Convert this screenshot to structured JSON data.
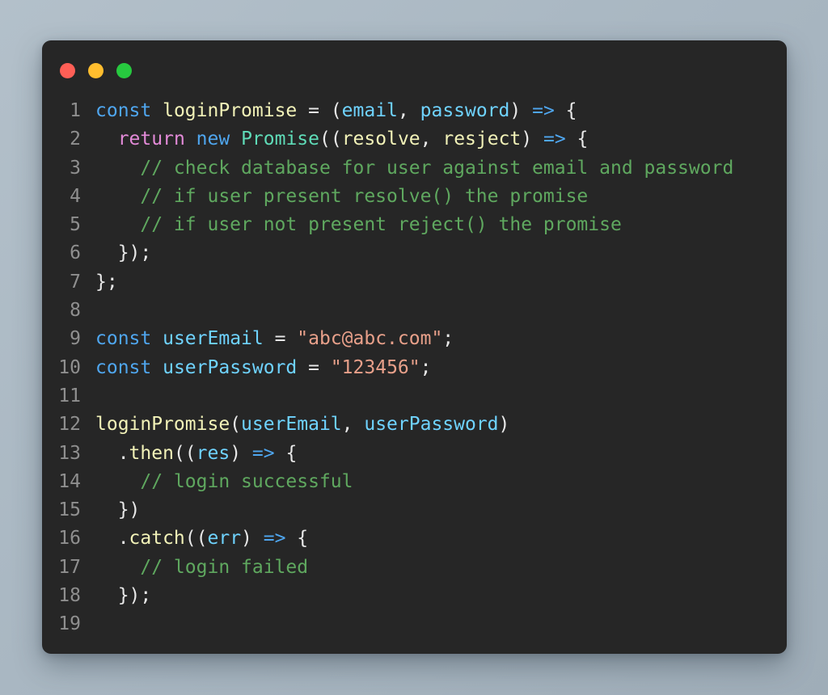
{
  "window": {
    "controls": [
      {
        "name": "close",
        "label": "Close",
        "color": "#ff5f56"
      },
      {
        "name": "minimize",
        "label": "Minimize",
        "color": "#ffbd2e"
      },
      {
        "name": "maximize",
        "label": "Maximize",
        "color": "#27c93f"
      }
    ]
  },
  "theme": {
    "page_background": "#aebcc6",
    "card_background": "#262626",
    "line_number_color": "#8f8f8f",
    "default_text": "#e8e8e8",
    "keyword": "#4fa6ef",
    "control_keyword": "#e48bd9",
    "class_name": "#5fdcb8",
    "function_name": "#f2f2b8",
    "variable": "#6fd3ff",
    "string": "#e8a08a",
    "comment": "#5fa85f",
    "arrow": "#4fa6ef"
  },
  "editor": {
    "language": "javascript",
    "line_count": 19,
    "line_numbers": [
      "1",
      "2",
      "3",
      "4",
      "5",
      "6",
      "7",
      "8",
      "9",
      "10",
      "11",
      "12",
      "13",
      "14",
      "15",
      "16",
      "17",
      "18",
      "19"
    ],
    "plain_text": [
      "const loginPromise = (email, password) => {",
      "  return new Promise((resolve, resject) => {",
      "    // check database for user against email and password",
      "    // if user present resolve() the promise",
      "    // if user not present reject() the promise",
      "  });",
      "};",
      "",
      "const userEmail = \"abc@abc.com\";",
      "const userPassword = \"123456\";",
      "",
      "loginPromise(userEmail, userPassword)",
      "  .then((res) => {",
      "    // login successful",
      "  })",
      "  .catch((err) => {",
      "    // login failed",
      "  });",
      ""
    ],
    "lines": [
      {
        "n": "1",
        "tokens": [
          {
            "t": "const",
            "c": "t-keyword"
          },
          {
            "t": " ",
            "c": "t-plain"
          },
          {
            "t": "loginPromise",
            "c": "t-function"
          },
          {
            "t": " = (",
            "c": "t-plain"
          },
          {
            "t": "email",
            "c": "t-variable"
          },
          {
            "t": ", ",
            "c": "t-plain"
          },
          {
            "t": "password",
            "c": "t-variable"
          },
          {
            "t": ") ",
            "c": "t-plain"
          },
          {
            "t": "=>",
            "c": "t-arrow"
          },
          {
            "t": " {",
            "c": "t-plain"
          }
        ]
      },
      {
        "n": "2",
        "tokens": [
          {
            "t": "  ",
            "c": "t-plain"
          },
          {
            "t": "return",
            "c": "t-control"
          },
          {
            "t": " ",
            "c": "t-plain"
          },
          {
            "t": "new",
            "c": "t-keyword"
          },
          {
            "t": " ",
            "c": "t-plain"
          },
          {
            "t": "Promise",
            "c": "t-class"
          },
          {
            "t": "((",
            "c": "t-plain"
          },
          {
            "t": "resolve",
            "c": "t-param"
          },
          {
            "t": ", ",
            "c": "t-plain"
          },
          {
            "t": "resject",
            "c": "t-param"
          },
          {
            "t": ") ",
            "c": "t-plain"
          },
          {
            "t": "=>",
            "c": "t-arrow"
          },
          {
            "t": " {",
            "c": "t-plain"
          }
        ]
      },
      {
        "n": "3",
        "tokens": [
          {
            "t": "    ",
            "c": "t-plain"
          },
          {
            "t": "// check database for user against email and password",
            "c": "t-comment"
          }
        ]
      },
      {
        "n": "4",
        "tokens": [
          {
            "t": "    ",
            "c": "t-plain"
          },
          {
            "t": "// if user present resolve() the promise",
            "c": "t-comment"
          }
        ]
      },
      {
        "n": "5",
        "tokens": [
          {
            "t": "    ",
            "c": "t-plain"
          },
          {
            "t": "// if user not present reject() the promise",
            "c": "t-comment"
          }
        ]
      },
      {
        "n": "6",
        "tokens": [
          {
            "t": "  });",
            "c": "t-plain"
          }
        ]
      },
      {
        "n": "7",
        "tokens": [
          {
            "t": "};",
            "c": "t-plain"
          }
        ]
      },
      {
        "n": "8",
        "tokens": [
          {
            "t": "",
            "c": "t-plain"
          }
        ]
      },
      {
        "n": "9",
        "tokens": [
          {
            "t": "const",
            "c": "t-keyword"
          },
          {
            "t": " ",
            "c": "t-plain"
          },
          {
            "t": "userEmail",
            "c": "t-variable"
          },
          {
            "t": " = ",
            "c": "t-plain"
          },
          {
            "t": "\"abc@abc.com\"",
            "c": "t-string"
          },
          {
            "t": ";",
            "c": "t-plain"
          }
        ]
      },
      {
        "n": "10",
        "tokens": [
          {
            "t": "const",
            "c": "t-keyword"
          },
          {
            "t": " ",
            "c": "t-plain"
          },
          {
            "t": "userPassword",
            "c": "t-variable"
          },
          {
            "t": " = ",
            "c": "t-plain"
          },
          {
            "t": "\"123456\"",
            "c": "t-string"
          },
          {
            "t": ";",
            "c": "t-plain"
          }
        ]
      },
      {
        "n": "11",
        "tokens": [
          {
            "t": "",
            "c": "t-plain"
          }
        ]
      },
      {
        "n": "12",
        "tokens": [
          {
            "t": "loginPromise",
            "c": "t-function"
          },
          {
            "t": "(",
            "c": "t-plain"
          },
          {
            "t": "userEmail",
            "c": "t-variable"
          },
          {
            "t": ", ",
            "c": "t-plain"
          },
          {
            "t": "userPassword",
            "c": "t-variable"
          },
          {
            "t": ")",
            "c": "t-plain"
          }
        ]
      },
      {
        "n": "13",
        "tokens": [
          {
            "t": "  .",
            "c": "t-plain"
          },
          {
            "t": "then",
            "c": "t-function"
          },
          {
            "t": "((",
            "c": "t-plain"
          },
          {
            "t": "res",
            "c": "t-variable"
          },
          {
            "t": ") ",
            "c": "t-plain"
          },
          {
            "t": "=>",
            "c": "t-arrow"
          },
          {
            "t": " {",
            "c": "t-plain"
          }
        ]
      },
      {
        "n": "14",
        "tokens": [
          {
            "t": "    ",
            "c": "t-plain"
          },
          {
            "t": "// login successful",
            "c": "t-comment"
          }
        ]
      },
      {
        "n": "15",
        "tokens": [
          {
            "t": "  })",
            "c": "t-plain"
          }
        ]
      },
      {
        "n": "16",
        "tokens": [
          {
            "t": "  .",
            "c": "t-plain"
          },
          {
            "t": "catch",
            "c": "t-function"
          },
          {
            "t": "((",
            "c": "t-plain"
          },
          {
            "t": "err",
            "c": "t-variable"
          },
          {
            "t": ") ",
            "c": "t-plain"
          },
          {
            "t": "=>",
            "c": "t-arrow"
          },
          {
            "t": " {",
            "c": "t-plain"
          }
        ]
      },
      {
        "n": "17",
        "tokens": [
          {
            "t": "    ",
            "c": "t-plain"
          },
          {
            "t": "// login failed",
            "c": "t-comment"
          }
        ]
      },
      {
        "n": "18",
        "tokens": [
          {
            "t": "  });",
            "c": "t-plain"
          }
        ]
      },
      {
        "n": "19",
        "tokens": [
          {
            "t": "",
            "c": "t-plain"
          }
        ]
      }
    ]
  }
}
